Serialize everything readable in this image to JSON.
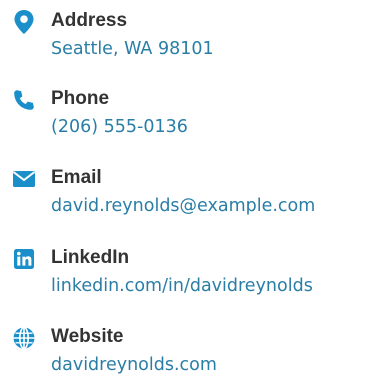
{
  "theme": {
    "icon_color": "#1a8fc9",
    "label_color": "#333333",
    "value_color": "#2a7ea6"
  },
  "contacts": [
    {
      "icon": "map-pin-icon",
      "label": "Address",
      "value": "Seattle, WA 98101"
    },
    {
      "icon": "phone-icon",
      "label": "Phone",
      "value": "(206) 555-0136"
    },
    {
      "icon": "envelope-icon",
      "label": "Email",
      "value": "david.reynolds@example.com"
    },
    {
      "icon": "linkedin-icon",
      "label": "LinkedIn",
      "value": "linkedin.com/in/davidreynolds"
    },
    {
      "icon": "globe-icon",
      "label": "Website",
      "value": "davidreynolds.com"
    }
  ]
}
